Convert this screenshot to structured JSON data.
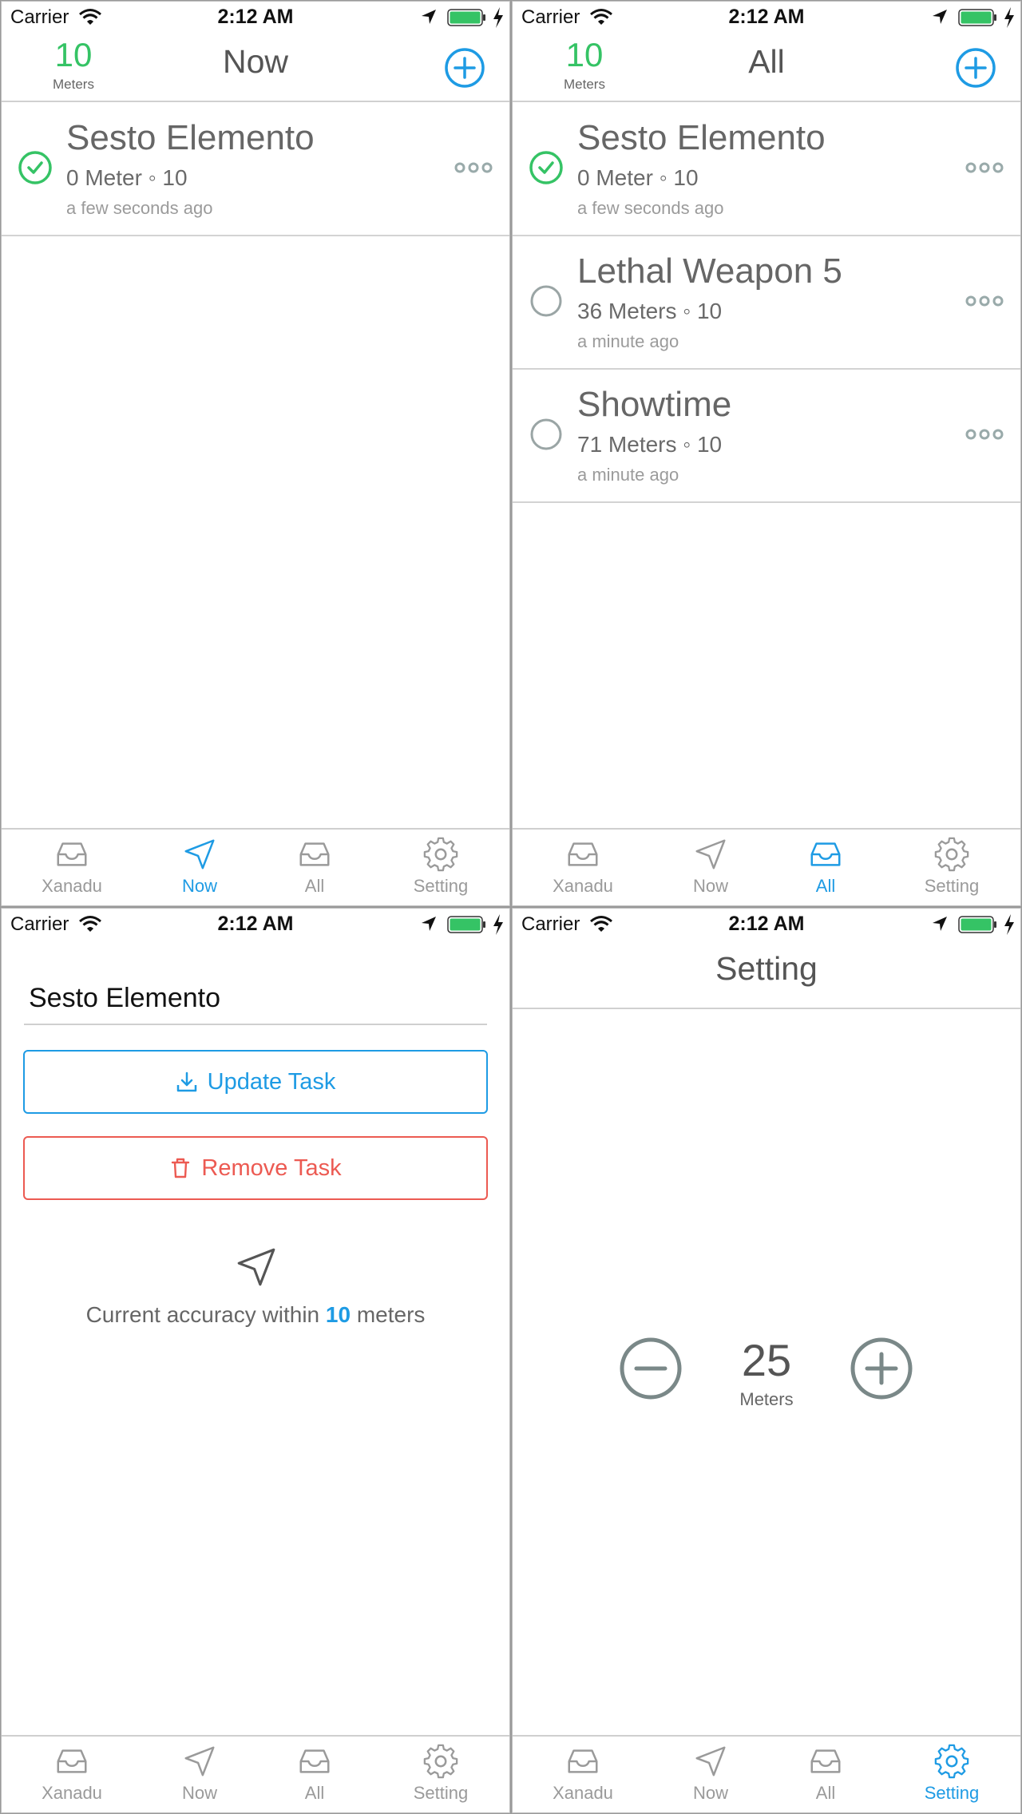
{
  "status_bar": {
    "carrier": "Carrier",
    "time": "2:12 AM"
  },
  "meter_count": {
    "value": "10",
    "unit": "Meters"
  },
  "colors": {
    "accent": "#1e9be4",
    "success": "#35c365",
    "danger": "#ec5a52",
    "muted": "#9a9a9a"
  },
  "tabs": [
    {
      "label": "Xanadu",
      "icon": "inbox-icon"
    },
    {
      "label": "Now",
      "icon": "navigation-arrow-icon"
    },
    {
      "label": "All",
      "icon": "inbox-icon"
    },
    {
      "label": "Setting",
      "icon": "gear-icon"
    }
  ],
  "screen_now": {
    "title": "Now",
    "tasks": [
      {
        "title": "Sesto Elemento",
        "subtitle": "0 Meter ◦ 10",
        "time": "a few seconds ago",
        "done": true
      }
    ]
  },
  "screen_all": {
    "title": "All",
    "tasks": [
      {
        "title": "Sesto Elemento",
        "subtitle": "0 Meter ◦ 10",
        "time": "a few seconds ago",
        "done": true
      },
      {
        "title": "Lethal Weapon 5",
        "subtitle": "36 Meters ◦ 10",
        "time": "a minute ago",
        "done": false
      },
      {
        "title": "Showtime",
        "subtitle": "71 Meters ◦ 10",
        "time": "a minute ago",
        "done": false
      }
    ]
  },
  "screen_edit": {
    "task_name": "Sesto Elemento",
    "update_label": "Update Task",
    "remove_label": "Remove Task",
    "accuracy_prefix": "Current accuracy within",
    "accuracy_value": "10",
    "accuracy_suffix": "meters"
  },
  "screen_setting": {
    "title": "Setting",
    "radius_value": "25",
    "radius_unit": "Meters"
  }
}
